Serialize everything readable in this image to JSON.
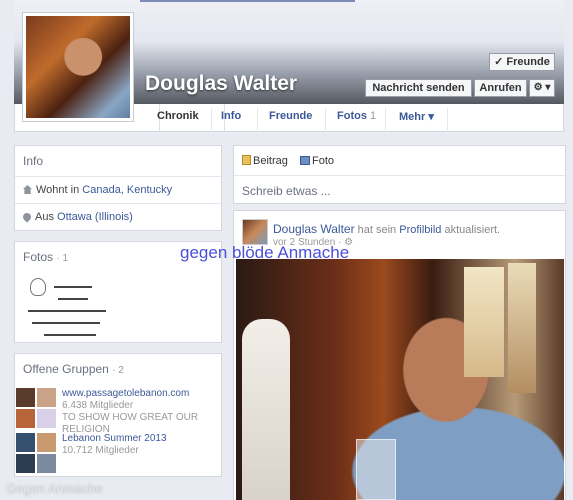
{
  "profile": {
    "name": "Douglas Walter",
    "friends_button": "✓ Freunde",
    "message_button": "Nachricht senden",
    "call_button": "Anrufen",
    "gear_button": "⚙ ▾"
  },
  "tabs": [
    {
      "label": "Chronik",
      "count": ""
    },
    {
      "label": "Info",
      "count": ""
    },
    {
      "label": "Freunde",
      "count": ""
    },
    {
      "label": "Fotos",
      "count": "1"
    },
    {
      "label": "Mehr ▾",
      "count": ""
    }
  ],
  "info_box": {
    "title": "Info",
    "lives_prefix": "Wohnt in ",
    "lives_link": "Canada, Kentucky",
    "from_prefix": "Aus ",
    "from_link": "Ottawa (Illinois)"
  },
  "photos_box": {
    "title": "Fotos",
    "count": "· 1"
  },
  "groups_box": {
    "title": "Offene Gruppen",
    "count": "· 2",
    "groups": [
      {
        "name": "www.passagetolebanon.com",
        "members": "6.438 Mitglieder",
        "extra": "TO SHOW HOW GREAT OUR",
        "extra2": "RELIGION"
      },
      {
        "name": "Lebanon Summer 2013",
        "members": "10.712 Mitglieder"
      }
    ]
  },
  "composer": {
    "tab_post": "Beitrag",
    "tab_photo": "Foto",
    "placeholder": "Schreib etwas ..."
  },
  "post": {
    "author": "Douglas Walter",
    "action_prefix": " hat sein ",
    "action_link": "Profilbild",
    "action_suffix": " aktualisiert.",
    "time": "vor 2 Stunden · ⚙"
  },
  "watermarks": {
    "top": "gegen blöde Anmache",
    "bottom": "Gegen Anmache"
  }
}
